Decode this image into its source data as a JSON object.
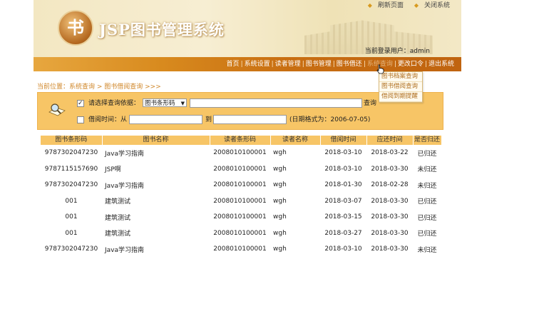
{
  "header": {
    "logo_char": "书",
    "app_title": "JSP图书管理系统",
    "top_links": [
      {
        "icon": "pin-icon",
        "label": "刷新页面"
      },
      {
        "icon": "pin-icon",
        "label": "关闭系统"
      }
    ],
    "current_user": "当前登录用户：admin"
  },
  "nav": {
    "items": [
      "首页",
      "系统设置",
      "读者管理",
      "图书管理",
      "图书借还",
      "系统查询",
      "更改口令",
      "退出系统"
    ],
    "separator": "|"
  },
  "dropdown": {
    "items": [
      "图书档案查询",
      "图书借阅查询",
      "借阅到期提醒"
    ]
  },
  "breadcrumb": "当前位置：系统查询 > 图书借阅查询 >>>",
  "search": {
    "row1_label": "请选择查询依据：",
    "select_value": "图书条形码",
    "query_button": "查询",
    "row2_label": "借阅时间：从",
    "to_label": "到",
    "date_hint": "(日期格式为：2006-07-05)"
  },
  "table": {
    "headers": [
      "图书条形码",
      "图书名称",
      "读者条形码",
      "读者名称",
      "借阅时间",
      "应还时间",
      "是否归还"
    ],
    "rows": [
      [
        "9787302047230",
        "Java学习指南",
        "2008010100001",
        "wgh",
        "2018-03-10",
        "2018-03-22",
        "已归还"
      ],
      [
        "9787115157690",
        "JSP啊",
        "2008010100001",
        "wgh",
        "2018-03-10",
        "2018-03-30",
        "未归还"
      ],
      [
        "9787302047230",
        "Java学习指南",
        "2008010100001",
        "wgh",
        "2018-01-30",
        "2018-02-28",
        "未归还"
      ],
      [
        "001",
        "建筑测试",
        "2008010100001",
        "wgh",
        "2018-03-07",
        "2018-03-30",
        "已归还"
      ],
      [
        "001",
        "建筑测试",
        "2008010100001",
        "wgh",
        "2018-03-15",
        "2018-03-30",
        "已归还"
      ],
      [
        "001",
        "建筑测试",
        "2008010100001",
        "wgh",
        "2018-03-27",
        "2018-03-30",
        "已归还"
      ],
      [
        "9787302047230",
        "Java学习指南",
        "2008010100001",
        "wgh",
        "2018-03-10",
        "2018-03-30",
        "未归还"
      ]
    ]
  },
  "colors": {
    "nav_bar": "#d88a1e",
    "search_panel": "#f7c566",
    "breadcrumb": "#d0872a"
  }
}
